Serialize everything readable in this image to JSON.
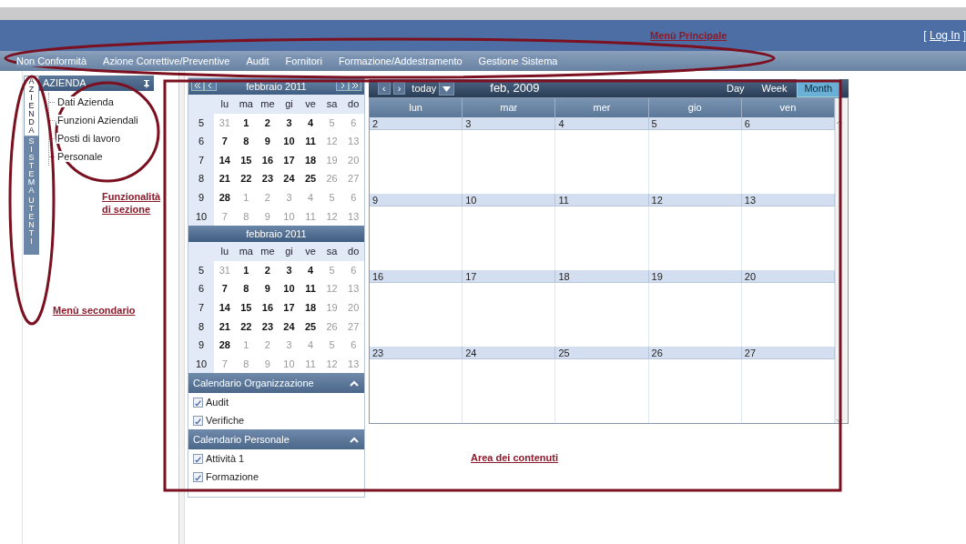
{
  "header": {
    "login_open": "[",
    "login_link": "Log In",
    "login_close": "]"
  },
  "main_menu": [
    "Non Conformità",
    "Azione Correttive/Preventive",
    "Audit",
    "Fornitori",
    "Formazione/Addestramento",
    "Gestione Sistema"
  ],
  "side_tabs": [
    {
      "label": "AZIENDA",
      "selected": true
    },
    {
      "label": "SISTEMA",
      "selected": false
    },
    {
      "label": "UTENTI",
      "selected": false
    }
  ],
  "panel": {
    "title": "AZIENDA",
    "items": [
      "Dati Azienda",
      "Funzioni Aziendali",
      "Posti di lavoro",
      "Personale"
    ]
  },
  "mini_calendars": [
    {
      "title": "febbraio 2011",
      "nav": true,
      "weekdays": [
        "lu",
        "ma",
        "me",
        "gi",
        "ve",
        "sa",
        "do"
      ],
      "weeks": [
        {
          "week": "5",
          "days": [
            {
              "text": "31",
              "muted": true
            },
            {
              "text": "1",
              "muted": false
            },
            {
              "text": "2",
              "muted": false
            },
            {
              "text": "3",
              "muted": false
            },
            {
              "text": "4",
              "muted": false
            },
            {
              "text": "5",
              "muted": true
            },
            {
              "text": "6",
              "muted": true
            }
          ]
        },
        {
          "week": "6",
          "days": [
            {
              "text": "7",
              "muted": false
            },
            {
              "text": "8",
              "muted": false
            },
            {
              "text": "9",
              "muted": false
            },
            {
              "text": "10",
              "muted": false
            },
            {
              "text": "11",
              "muted": false
            },
            {
              "text": "12",
              "muted": true
            },
            {
              "text": "13",
              "muted": true
            }
          ]
        },
        {
          "week": "7",
          "days": [
            {
              "text": "14",
              "muted": false
            },
            {
              "text": "15",
              "muted": false
            },
            {
              "text": "16",
              "muted": false
            },
            {
              "text": "17",
              "muted": false
            },
            {
              "text": "18",
              "muted": false
            },
            {
              "text": "19",
              "muted": true
            },
            {
              "text": "20",
              "muted": true
            }
          ]
        },
        {
          "week": "8",
          "days": [
            {
              "text": "21",
              "muted": false
            },
            {
              "text": "22",
              "muted": false
            },
            {
              "text": "23",
              "muted": false
            },
            {
              "text": "24",
              "muted": false
            },
            {
              "text": "25",
              "muted": false
            },
            {
              "text": "26",
              "muted": true
            },
            {
              "text": "27",
              "muted": true
            }
          ]
        },
        {
          "week": "9",
          "days": [
            {
              "text": "28",
              "muted": false
            },
            {
              "text": "1",
              "muted": true
            },
            {
              "text": "2",
              "muted": true
            },
            {
              "text": "3",
              "muted": true
            },
            {
              "text": "4",
              "muted": true
            },
            {
              "text": "5",
              "muted": true
            },
            {
              "text": "6",
              "muted": true
            }
          ]
        },
        {
          "week": "10",
          "days": [
            {
              "text": "7",
              "muted": true
            },
            {
              "text": "8",
              "muted": true
            },
            {
              "text": "9",
              "muted": true
            },
            {
              "text": "10",
              "muted": true
            },
            {
              "text": "11",
              "muted": true
            },
            {
              "text": "12",
              "muted": true
            },
            {
              "text": "13",
              "muted": true
            }
          ]
        }
      ]
    },
    {
      "title": "febbraio 2011",
      "nav": false,
      "weekdays": [
        "lu",
        "ma",
        "me",
        "gi",
        "ve",
        "sa",
        "do"
      ],
      "weeks": [
        {
          "week": "5",
          "days": [
            {
              "text": "31",
              "muted": true
            },
            {
              "text": "1",
              "muted": false
            },
            {
              "text": "2",
              "muted": false
            },
            {
              "text": "3",
              "muted": false
            },
            {
              "text": "4",
              "muted": false
            },
            {
              "text": "5",
              "muted": true
            },
            {
              "text": "6",
              "muted": true
            }
          ]
        },
        {
          "week": "6",
          "days": [
            {
              "text": "7",
              "muted": false
            },
            {
              "text": "8",
              "muted": false
            },
            {
              "text": "9",
              "muted": false
            },
            {
              "text": "10",
              "muted": false
            },
            {
              "text": "11",
              "muted": false
            },
            {
              "text": "12",
              "muted": true
            },
            {
              "text": "13",
              "muted": true
            }
          ]
        },
        {
          "week": "7",
          "days": [
            {
              "text": "14",
              "muted": false
            },
            {
              "text": "15",
              "muted": false
            },
            {
              "text": "16",
              "muted": false
            },
            {
              "text": "17",
              "muted": false
            },
            {
              "text": "18",
              "muted": false
            },
            {
              "text": "19",
              "muted": true
            },
            {
              "text": "20",
              "muted": true
            }
          ]
        },
        {
          "week": "8",
          "days": [
            {
              "text": "21",
              "muted": false
            },
            {
              "text": "22",
              "muted": false
            },
            {
              "text": "23",
              "muted": false
            },
            {
              "text": "24",
              "muted": false
            },
            {
              "text": "25",
              "muted": false
            },
            {
              "text": "26",
              "muted": true
            },
            {
              "text": "27",
              "muted": true
            }
          ]
        },
        {
          "week": "9",
          "days": [
            {
              "text": "28",
              "muted": false
            },
            {
              "text": "1",
              "muted": true
            },
            {
              "text": "2",
              "muted": true
            },
            {
              "text": "3",
              "muted": true
            },
            {
              "text": "4",
              "muted": true
            },
            {
              "text": "5",
              "muted": true
            },
            {
              "text": "6",
              "muted": true
            }
          ]
        },
        {
          "week": "10",
          "days": [
            {
              "text": "7",
              "muted": true
            },
            {
              "text": "8",
              "muted": true
            },
            {
              "text": "9",
              "muted": true
            },
            {
              "text": "10",
              "muted": true
            },
            {
              "text": "11",
              "muted": true
            },
            {
              "text": "12",
              "muted": true
            },
            {
              "text": "13",
              "muted": true
            }
          ]
        }
      ]
    }
  ],
  "calendar_groups": [
    {
      "title": "Calendario Organizzazione",
      "expanded": true,
      "items": [
        {
          "label": "Audit",
          "checked": true
        },
        {
          "label": "Verifiche",
          "checked": true
        }
      ]
    },
    {
      "title": "Calendario Personale",
      "expanded": true,
      "items": [
        {
          "label": "Attività 1",
          "checked": true
        },
        {
          "label": "Formazione",
          "checked": true
        }
      ]
    }
  ],
  "scheduler": {
    "prev": "‹",
    "next": "›",
    "today": "today",
    "title": "feb, 2009",
    "views": [
      {
        "label": "Day",
        "selected": false
      },
      {
        "label": "Week",
        "selected": false
      },
      {
        "label": "Month",
        "selected": true
      }
    ],
    "weekdays": [
      "lun",
      "mar",
      "mer",
      "gio",
      "ven"
    ],
    "weeks": [
      [
        "2",
        "3",
        "4",
        "5",
        "6"
      ],
      [
        "9",
        "10",
        "11",
        "12",
        "13"
      ],
      [
        "16",
        "17",
        "18",
        "19",
        "20"
      ],
      [
        "23",
        "24",
        "25",
        "26",
        "27"
      ]
    ]
  },
  "annotations": [
    "Menù Principale",
    "Funzionalità di sezione",
    "Menù secondario",
    "Area dei contenuti"
  ]
}
